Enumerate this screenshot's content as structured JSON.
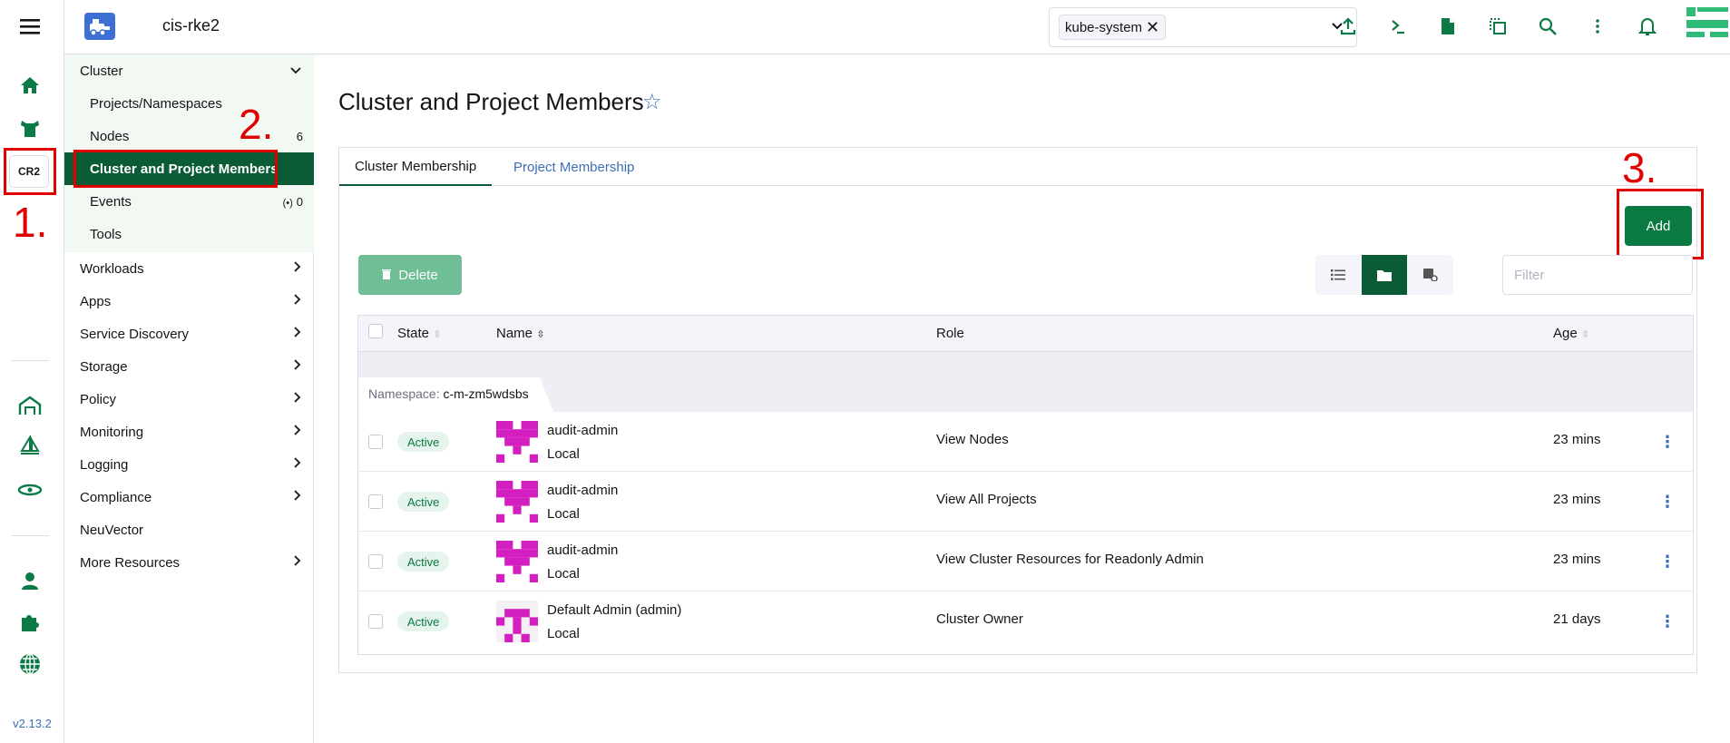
{
  "rail": {
    "cluster_badge": "CR2",
    "version": "v2.13.2",
    "icons": [
      "home-icon",
      "cluster-explorer-icon",
      "fleet-icon",
      "sailboat-icon",
      "eye-icon",
      "user-icon",
      "puzzle-icon",
      "globe-icon"
    ]
  },
  "header": {
    "cluster_name": "cis-rke2",
    "namespace_chip": "kube-system",
    "namespace_chip_remove": "✕",
    "namespace_caret": "⌄",
    "icons": [
      "upload-icon",
      "terminal-icon",
      "file-icon",
      "copy-icon",
      "search-icon",
      "more-icon",
      "bell-icon"
    ]
  },
  "sidenav": {
    "cluster_group": "Cluster",
    "cluster_items": [
      {
        "label": "Projects/Namespaces",
        "right": ""
      },
      {
        "label": "Nodes",
        "right": "6"
      },
      {
        "label": "Cluster and Project Members",
        "right": ""
      },
      {
        "label": "Events",
        "right": "0"
      },
      {
        "label": "Tools",
        "right": ""
      }
    ],
    "groups": [
      {
        "label": "Workloads",
        "chevron": true
      },
      {
        "label": "Apps",
        "chevron": true
      },
      {
        "label": "Service Discovery",
        "chevron": true
      },
      {
        "label": "Storage",
        "chevron": true
      },
      {
        "label": "Policy",
        "chevron": true
      },
      {
        "label": "Monitoring",
        "chevron": true
      },
      {
        "label": "Logging",
        "chevron": true
      },
      {
        "label": "Compliance",
        "chevron": true
      },
      {
        "label": "NeuVector",
        "chevron": false
      },
      {
        "label": "More Resources",
        "chevron": true
      }
    ]
  },
  "main": {
    "title": "Cluster and Project Members",
    "star": "☆",
    "tabs": [
      "Cluster Membership",
      "Project Membership"
    ],
    "add_label": "Add",
    "delete_label": "Delete",
    "filter_placeholder": "Filter",
    "columns": {
      "state": "State",
      "name": "Name",
      "role": "Role",
      "age": "Age"
    },
    "namespace_prefix": "Namespace:",
    "namespace_value": "c-m-zm5wdsbs",
    "rows": [
      {
        "state": "Active",
        "name": "audit-admin",
        "provider": "Local",
        "role": "View Nodes",
        "age": "23 mins"
      },
      {
        "state": "Active",
        "name": "audit-admin",
        "provider": "Local",
        "role": "View All Projects",
        "age": "23 mins"
      },
      {
        "state": "Active",
        "name": "audit-admin",
        "provider": "Local",
        "role": "View Cluster Resources for Readonly Admin",
        "age": "23 mins"
      },
      {
        "state": "Active",
        "name": "Default Admin (admin)",
        "provider": "Local",
        "role": "Cluster Owner",
        "age": "21 days"
      }
    ]
  },
  "annotations": [
    "1.",
    "2.",
    "3."
  ],
  "colors": {
    "accent": "#0a5b36",
    "primary_button": "#0a7a42",
    "link": "#3d6fb4",
    "annotation": "#e00000",
    "avatar": "#d41fc0"
  }
}
